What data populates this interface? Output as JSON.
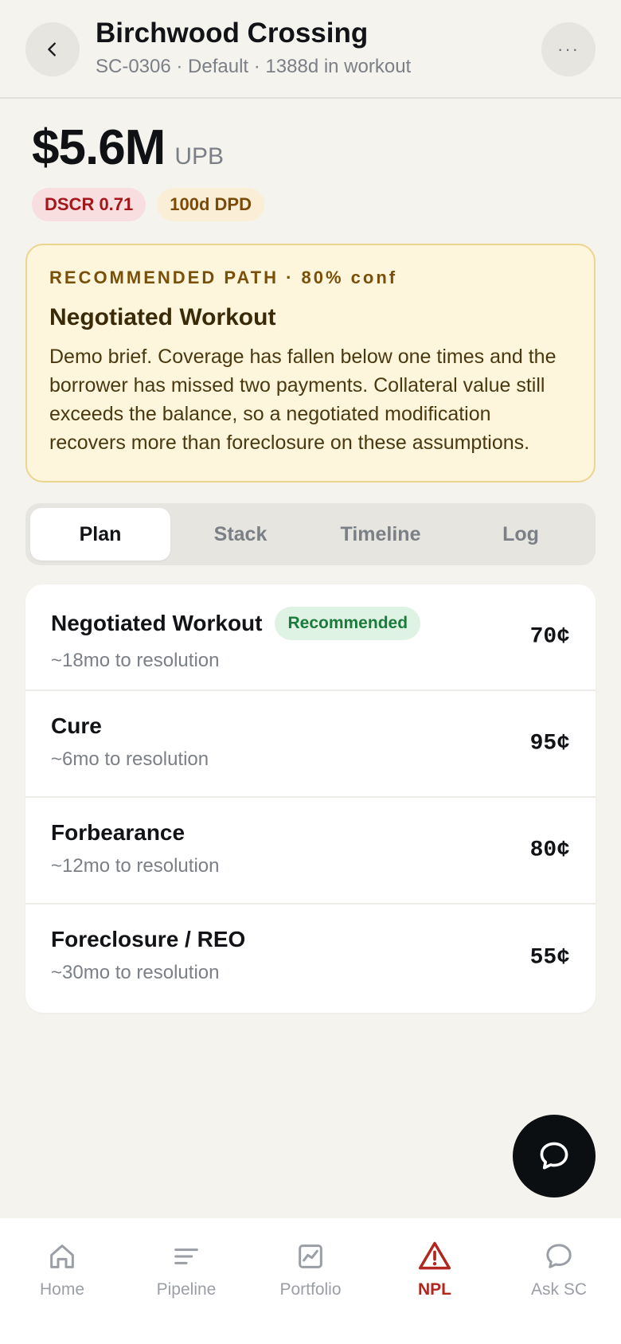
{
  "header": {
    "title": "Birchwood Crossing",
    "subtitle": "SC-0306 · Default · 1388d in workout",
    "more_label": "···"
  },
  "balance": {
    "value": "$5.6M",
    "label": "UPB"
  },
  "badges": [
    {
      "label": "DSCR 0.71",
      "color": "#a4161a"
    },
    {
      "label": "100d DPD",
      "color": "#7a4a07"
    }
  ],
  "recommendation": {
    "eyebrow": "RECOMMENDED PATH · 80% conf",
    "title": "Negotiated Workout",
    "body": "Demo brief. Coverage has fallen below one times and the borrower has missed two payments. Collateral value still exceeds the balance, so a negotiated modification recovers more than foreclosure on these assumptions."
  },
  "tabs": [
    {
      "label": "Plan",
      "active": true
    },
    {
      "label": "Stack",
      "active": false
    },
    {
      "label": "Timeline",
      "active": false
    },
    {
      "label": "Log",
      "active": false
    }
  ],
  "options": [
    {
      "name": "Negotiated Workout",
      "tag": "Recommended",
      "sub": "~18mo to resolution",
      "price": "70¢"
    },
    {
      "name": "Cure",
      "sub": "~6mo to resolution",
      "price": "95¢"
    },
    {
      "name": "Forbearance",
      "sub": "~12mo to resolution",
      "price": "80¢"
    },
    {
      "name": "Foreclosure / REO",
      "sub": "~30mo to resolution",
      "price": "55¢"
    }
  ],
  "nav": [
    {
      "label": "Home",
      "icon": "home-icon"
    },
    {
      "label": "Pipeline",
      "icon": "pipeline-icon"
    },
    {
      "label": "Portfolio",
      "icon": "portfolio-icon"
    },
    {
      "label": "NPL",
      "icon": "warning-icon",
      "active": true
    },
    {
      "label": "Ask SC",
      "icon": "chat-icon"
    }
  ],
  "colors": {
    "accent_red": "#b1261f",
    "background": "#f4f3ee",
    "recommended_bg": "#fdf6dc",
    "recommended_tag": "#1c7a3c"
  }
}
